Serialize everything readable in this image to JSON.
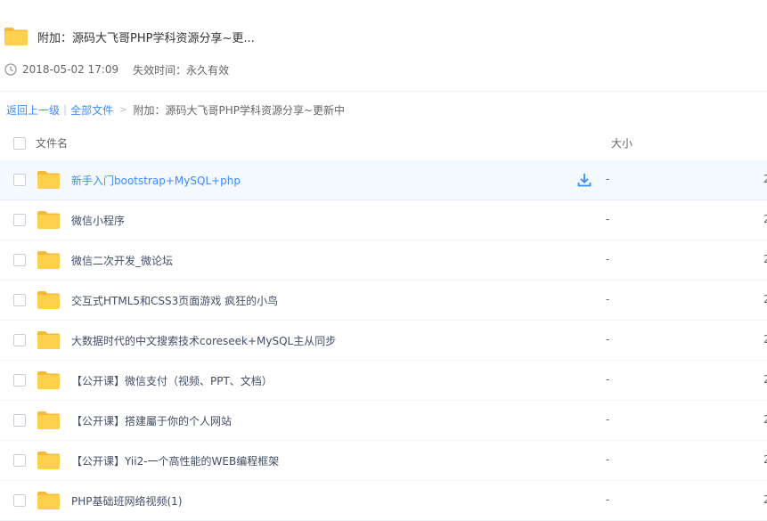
{
  "header": {
    "title": "附加：源码大飞哥PHP学科资源分享~更...",
    "date": "2018-05-02 17:09",
    "expiry": "失效时间：永久有效"
  },
  "breadcrumb": {
    "back": "返回上一级",
    "sep": "|",
    "all_files": "全部文件",
    "arrow": ">",
    "current": "附加：源码大飞哥PHP学科资源分享~更新中"
  },
  "list_header": {
    "name": "文件名",
    "size": "大小"
  },
  "files": [
    {
      "name": "新手入门bootstrap+MySQL+php",
      "size": "-",
      "clip": "2"
    },
    {
      "name": "微信小程序",
      "size": "-",
      "clip": "2"
    },
    {
      "name": "微信二次开发_微论坛",
      "size": "-",
      "clip": "2"
    },
    {
      "name": "交互式HTML5和CSS3页面游戏 疯狂的小鸟",
      "size": "-",
      "clip": "2"
    },
    {
      "name": "大数据时代的中文搜索技术coreseek+MySQL主从同步",
      "size": "-",
      "clip": "2"
    },
    {
      "name": "【公开课】微信支付（视频、PPT、文档）",
      "size": "-",
      "clip": "2"
    },
    {
      "name": "【公开课】搭建屬于你的个人网站",
      "size": "-",
      "clip": "2"
    },
    {
      "name": "【公开课】Yii2-一个高性能的WEB编程框架",
      "size": "-",
      "clip": "2"
    },
    {
      "name": "PHP基础班网络视频(1)",
      "size": "-",
      "clip": "2"
    }
  ],
  "colors": {
    "accent": "#3b8cff",
    "folder": "#ffd04b",
    "folder_dark": "#f5b93a"
  }
}
